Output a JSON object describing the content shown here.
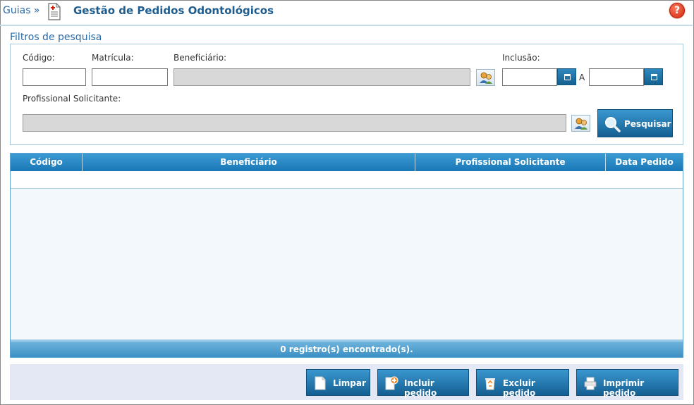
{
  "header": {
    "breadcrumb": "Guias »",
    "title": "Gestão de Pedidos Odontológicos",
    "help_label": "?"
  },
  "filters": {
    "legend": "Filtros de pesquisa",
    "codigo_label": "Código:",
    "matricula_label": "Matrícula:",
    "beneficiario_label": "Beneficiário:",
    "inclusao_label": "Inclusão:",
    "range_separator": "A",
    "profissional_label": "Profissional Solicitante:",
    "codigo_value": "",
    "matricula_value": "",
    "beneficiario_value": "",
    "inclusao_from": "",
    "inclusao_to": "",
    "profissional_value": "",
    "search_button": "Pesquisar"
  },
  "grid": {
    "columns": [
      "Código",
      "Beneficiário",
      "Profissional Solicitante",
      "Data Pedido"
    ],
    "rows": [],
    "footer": "0 registro(s) encontrado(s)."
  },
  "actions": {
    "limpar": "Limpar",
    "incluir": "Incluir pedido",
    "excluir": "Excluir pedido",
    "imprimir": "Imprimir pedido"
  },
  "icons": {
    "doc": "document-icon",
    "help": "help-icon",
    "lookup": "people-lookup-icon",
    "calendar": "calendar-icon",
    "search": "magnifier-icon",
    "clear": "blank-page-icon",
    "add": "add-document-icon",
    "delete": "recycle-delete-icon",
    "print": "printer-icon"
  },
  "colors": {
    "accent": "#1f5d8f",
    "button": "#1a77b6",
    "help": "#d0240c"
  }
}
